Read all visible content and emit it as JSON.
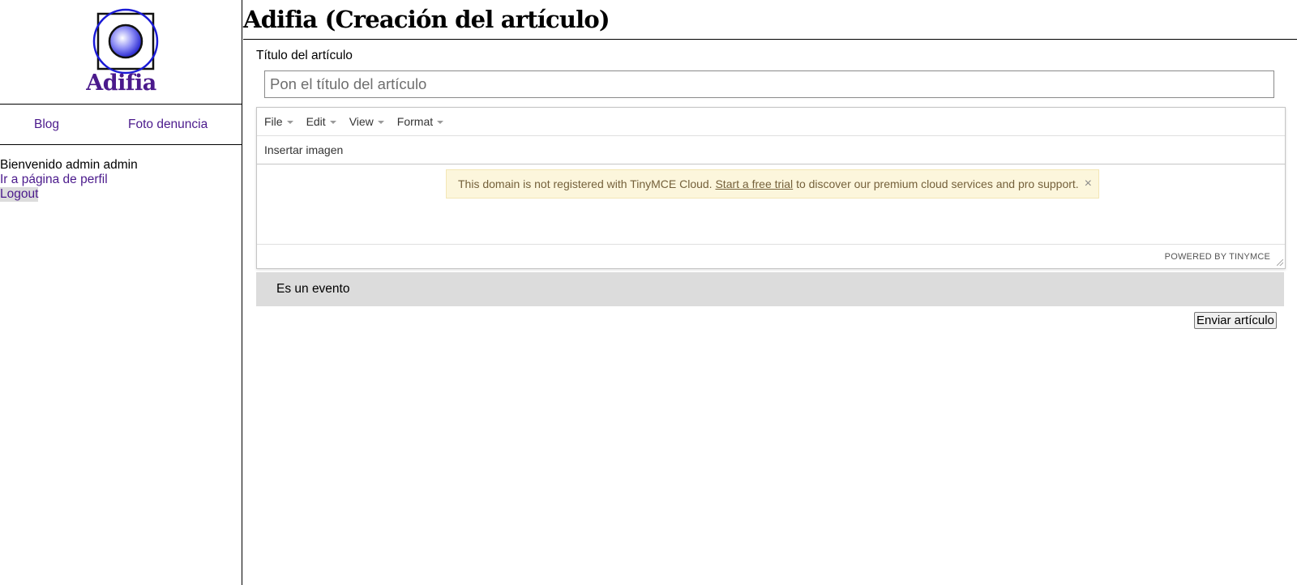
{
  "sidebar": {
    "brand": "Adifia",
    "nav": {
      "blog": "Blog",
      "foto_denuncia": "Foto denuncia"
    },
    "welcome": "Bienvenido admin admin",
    "profile_link": "Ir a página de perfil",
    "logout": "Logout"
  },
  "main": {
    "title": "Adifia (Creación del artículo)",
    "article_title_label": "Título del artículo",
    "article_title_placeholder": "Pon el título del artículo",
    "editor": {
      "menu": [
        "File",
        "Edit",
        "View",
        "Format"
      ],
      "toolbar_insert_image": "Insertar imagen",
      "notice": {
        "text_before": "This domain is not registered with TinyMCE Cloud.",
        "link": "Start a free trial",
        "text_after": "to discover our premium cloud services and pro support.",
        "close": "×"
      },
      "powered_by": "POWERED BY TINYMCE"
    },
    "event_label": "Es un evento",
    "submit": "Enviar artículo"
  },
  "colors": {
    "brand": "#4b1a8c",
    "notice_bg": "#fcf6dc",
    "event_row_bg": "#dcdcdc"
  }
}
